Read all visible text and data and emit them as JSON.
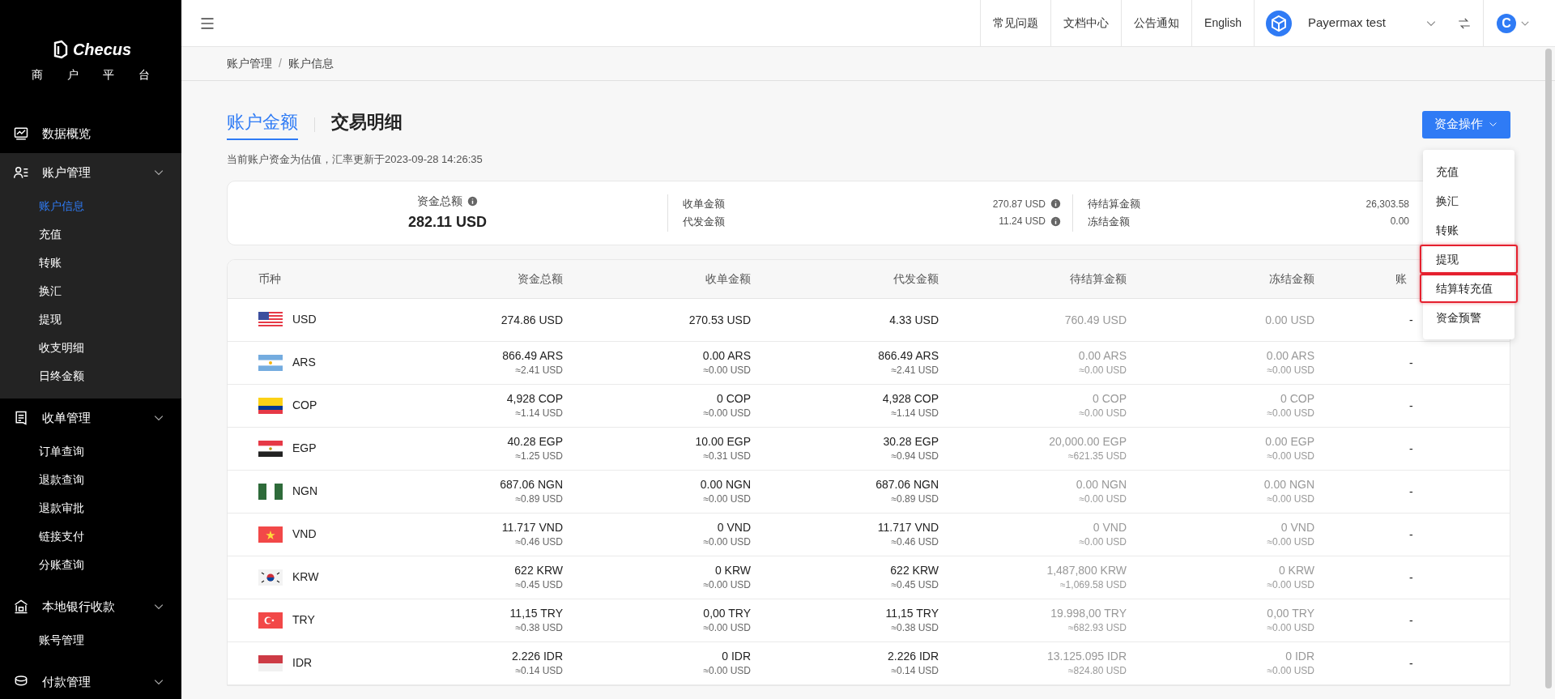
{
  "sidebar": {
    "logo": {
      "name": "Checus",
      "subtitle": [
        "商",
        "户",
        "平",
        "台"
      ]
    },
    "groups": [
      {
        "label": "数据概览"
      },
      {
        "label": "账户管理",
        "expanded": true,
        "items": [
          {
            "label": "账户信息",
            "selected": true
          },
          {
            "label": "充值",
            "selected": false
          },
          {
            "label": "转账",
            "selected": false
          },
          {
            "label": "换汇",
            "selected": false
          },
          {
            "label": "提现",
            "selected": false
          },
          {
            "label": "收支明细",
            "selected": false
          },
          {
            "label": "日终金额",
            "selected": false
          }
        ]
      },
      {
        "label": "收单管理",
        "expanded": true,
        "items": [
          {
            "label": "订单查询",
            "selected": false
          },
          {
            "label": "退款查询",
            "selected": false
          },
          {
            "label": "退款审批",
            "selected": false
          },
          {
            "label": "链接支付",
            "selected": false
          },
          {
            "label": "分账查询",
            "selected": false
          }
        ]
      },
      {
        "label": "本地银行收款",
        "expanded": true,
        "items": [
          {
            "label": "账号管理",
            "selected": false
          }
        ]
      },
      {
        "label": "付款管理",
        "expanded": true
      }
    ]
  },
  "top_bar": {
    "links": [
      "常见问题",
      "文档中心",
      "公告通知",
      "English"
    ],
    "merchant": "Payermax test",
    "avatar": "C"
  },
  "breadcrumb": [
    "账户管理",
    "/",
    "账户信息"
  ],
  "tabs": [
    {
      "label": "账户金额",
      "selected": true
    },
    {
      "label": "交易明细",
      "selected": false
    }
  ],
  "note": "当前账户资金为估值，汇率更新于2023-09-28 14:26:35",
  "action_button": "资金操作",
  "dropdown": [
    {
      "label": "充值",
      "highlighted": false
    },
    {
      "label": "换汇",
      "highlighted": false
    },
    {
      "label": "转账",
      "highlighted": false
    },
    {
      "label": "提现",
      "highlighted": true
    },
    {
      "label": "结算转充值",
      "highlighted": true
    },
    {
      "label": "资金预警",
      "highlighted": false
    }
  ],
  "summary": {
    "total_label": "资金总额",
    "total": "282.11 USD",
    "middle": [
      {
        "label": "收单金额",
        "value": "270.87 USD"
      },
      {
        "label": "代发金额",
        "value": "11.24 USD"
      }
    ],
    "right": [
      {
        "label": "待结算金额",
        "value": "26,303.58"
      },
      {
        "label": "冻结金额",
        "value": "0.00"
      }
    ]
  },
  "table": {
    "columns": [
      "币种",
      "资金总额",
      "收单金额",
      "代发金额",
      "待结算金额",
      "冻结金额",
      "账"
    ],
    "rows": [
      {
        "kind": "us",
        "cells": [
          {
            "main": "USD"
          },
          {
            "main": "274.86 USD"
          },
          {
            "main": "270.53 USD"
          },
          {
            "main": "4.33 USD"
          },
          {
            "main": "760.49 USD"
          },
          {
            "main": "0.00 USD"
          },
          {
            "main": "-"
          }
        ]
      },
      {
        "kind": "ar",
        "cells": [
          {
            "main": "ARS"
          },
          {
            "main": "866.49 ARS",
            "sub": "≈2.41 USD"
          },
          {
            "main": "0.00 ARS",
            "sub": "≈0.00 USD"
          },
          {
            "main": "866.49 ARS",
            "sub": "≈2.41 USD"
          },
          {
            "main": "0.00 ARS",
            "sub": "≈0.00 USD"
          },
          {
            "main": "0.00 ARS",
            "sub": "≈0.00 USD"
          },
          {
            "main": "-"
          }
        ]
      },
      {
        "kind": "co",
        "cells": [
          {
            "main": "COP"
          },
          {
            "main": "4,928 COP",
            "sub": "≈1.14 USD"
          },
          {
            "main": "0 COP",
            "sub": "≈0.00 USD"
          },
          {
            "main": "4,928 COP",
            "sub": "≈1.14 USD"
          },
          {
            "main": "0 COP",
            "sub": "≈0.00 USD"
          },
          {
            "main": "0 COP",
            "sub": "≈0.00 USD"
          },
          {
            "main": "-"
          }
        ]
      },
      {
        "kind": "eg",
        "cells": [
          {
            "main": "EGP"
          },
          {
            "main": "40.28 EGP",
            "sub": "≈1.25 USD"
          },
          {
            "main": "10.00 EGP",
            "sub": "≈0.31 USD"
          },
          {
            "main": "30.28 EGP",
            "sub": "≈0.94 USD"
          },
          {
            "main": "20,000.00 EGP",
            "sub": "≈621.35 USD"
          },
          {
            "main": "0.00 EGP",
            "sub": "≈0.00 USD"
          },
          {
            "main": "-"
          }
        ]
      },
      {
        "kind": "ng",
        "cells": [
          {
            "main": "NGN"
          },
          {
            "main": "687.06 NGN",
            "sub": "≈0.89 USD"
          },
          {
            "main": "0.00 NGN",
            "sub": "≈0.00 USD"
          },
          {
            "main": "687.06 NGN",
            "sub": "≈0.89 USD"
          },
          {
            "main": "0.00 NGN",
            "sub": "≈0.00 USD"
          },
          {
            "main": "0.00 NGN",
            "sub": "≈0.00 USD"
          },
          {
            "main": "-"
          }
        ]
      },
      {
        "kind": "vn",
        "cells": [
          {
            "main": "VND"
          },
          {
            "main": "11.717 VND",
            "sub": "≈0.46 USD"
          },
          {
            "main": "0 VND",
            "sub": "≈0.00 USD"
          },
          {
            "main": "11.717 VND",
            "sub": "≈0.46 USD"
          },
          {
            "main": "0 VND",
            "sub": "≈0.00 USD"
          },
          {
            "main": "0 VND",
            "sub": "≈0.00 USD"
          },
          {
            "main": "-"
          }
        ]
      },
      {
        "kind": "kr",
        "cells": [
          {
            "main": "KRW"
          },
          {
            "main": "622 KRW",
            "sub": "≈0.45 USD"
          },
          {
            "main": "0 KRW",
            "sub": "≈0.00 USD"
          },
          {
            "main": "622 KRW",
            "sub": "≈0.45 USD"
          },
          {
            "main": "1,487,800 KRW",
            "sub": "≈1,069.58 USD"
          },
          {
            "main": "0 KRW",
            "sub": "≈0.00 USD"
          },
          {
            "main": "-"
          }
        ]
      },
      {
        "kind": "tr",
        "cells": [
          {
            "main": "TRY"
          },
          {
            "main": "11,15 TRY",
            "sub": "≈0.38 USD"
          },
          {
            "main": "0,00 TRY",
            "sub": "≈0.00 USD"
          },
          {
            "main": "11,15 TRY",
            "sub": "≈0.38 USD"
          },
          {
            "main": "19.998,00 TRY",
            "sub": "≈682.93 USD"
          },
          {
            "main": "0,00 TRY",
            "sub": "≈0.00 USD"
          },
          {
            "main": "-"
          }
        ]
      },
      {
        "kind": "id",
        "cells": [
          {
            "main": "IDR"
          },
          {
            "main": "2.226 IDR",
            "sub": "≈0.14 USD"
          },
          {
            "main": "0 IDR",
            "sub": "≈0.00 USD"
          },
          {
            "main": "2.226 IDR",
            "sub": "≈0.14 USD"
          },
          {
            "main": "13.125.095 IDR",
            "sub": "≈824.80 USD"
          },
          {
            "main": "0 IDR",
            "sub": "≈0.00 USD"
          },
          {
            "main": "-"
          }
        ]
      }
    ]
  }
}
